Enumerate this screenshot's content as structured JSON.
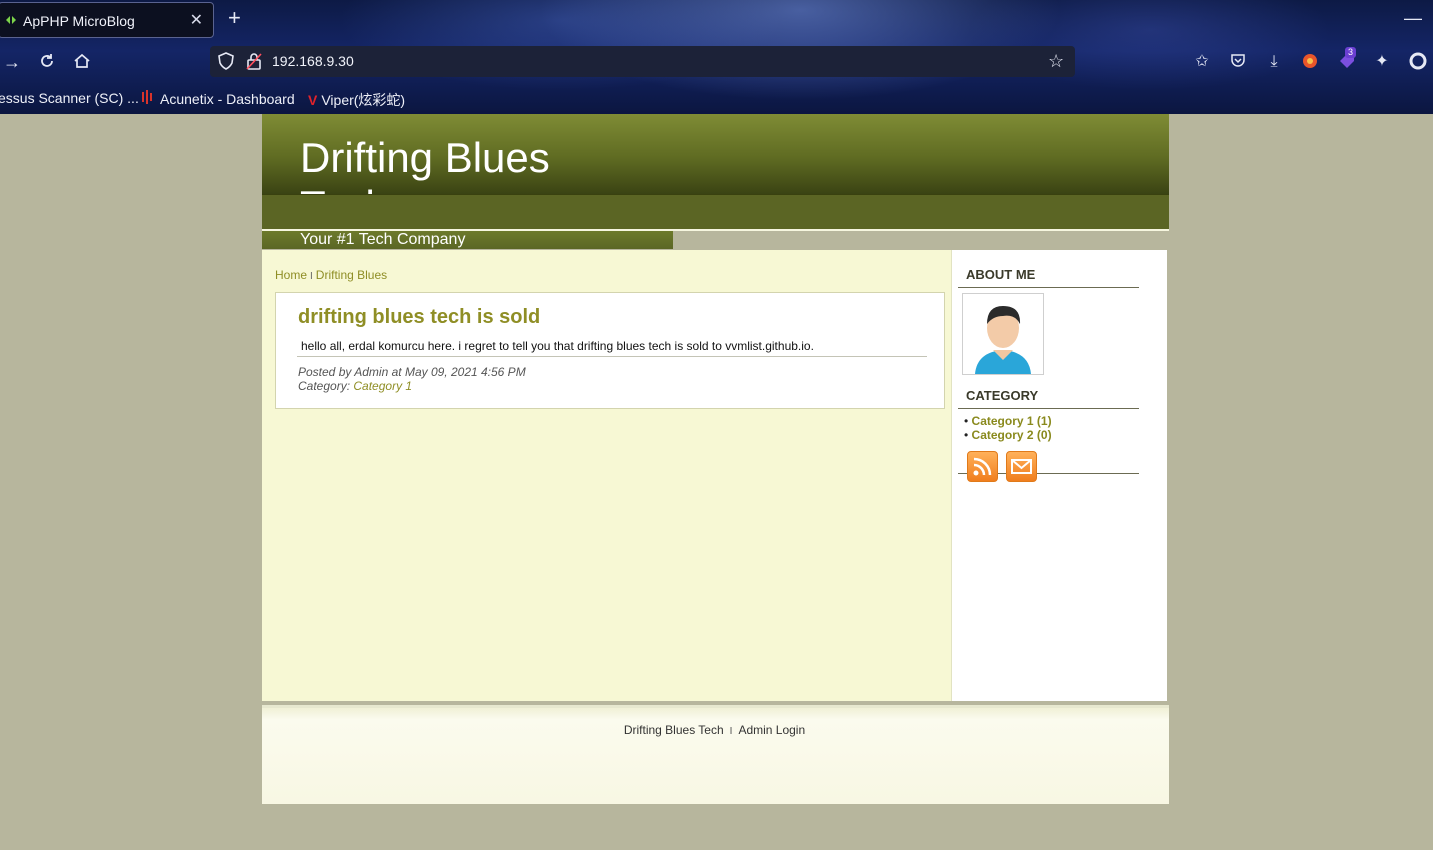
{
  "browser": {
    "tab_title": "ApPHP MicroBlog",
    "url": "192.168.9.30",
    "extension_badge": "3",
    "bookmarks": [
      {
        "label": "essus Scanner (SC) ...",
        "icon": "nessus-icon"
      },
      {
        "label": "Acunetix - Dashboard",
        "icon": "acunetix-icon"
      },
      {
        "label": "Viper(炫彩蛇)",
        "icon": "viper-icon"
      }
    ]
  },
  "site": {
    "title": "Drifting Blues Tech",
    "slogan": "Your #1 Tech Company"
  },
  "breadcrumb": {
    "home": "Home",
    "separator": "I",
    "current": "Drifting Blues"
  },
  "post": {
    "title": "drifting blues tech is sold",
    "body": "hello all, erdal komurcu here. i regret to tell you that drifting blues tech is sold to vvmlist.github.io.",
    "meta": "Posted by Admin at May 09, 2021 4:56 PM",
    "category_prefix": "Category:",
    "category": "Category 1"
  },
  "sidebar": {
    "about_heading": "ABOUT ME",
    "category_heading": "CATEGORY",
    "categories": [
      {
        "label": "Category 1 (1)"
      },
      {
        "label": "Category 2 (0)"
      }
    ],
    "feed_icons": [
      "rss-icon",
      "email-icon"
    ]
  },
  "footer": {
    "site_link": "Drifting Blues Tech",
    "separator": "I",
    "admin_link": "Admin Login"
  },
  "colors": {
    "page_background": "#b7b69d",
    "header_green": "#5f6b22",
    "accent_olive": "#8f8e25",
    "content_background": "#f7f8d4"
  }
}
